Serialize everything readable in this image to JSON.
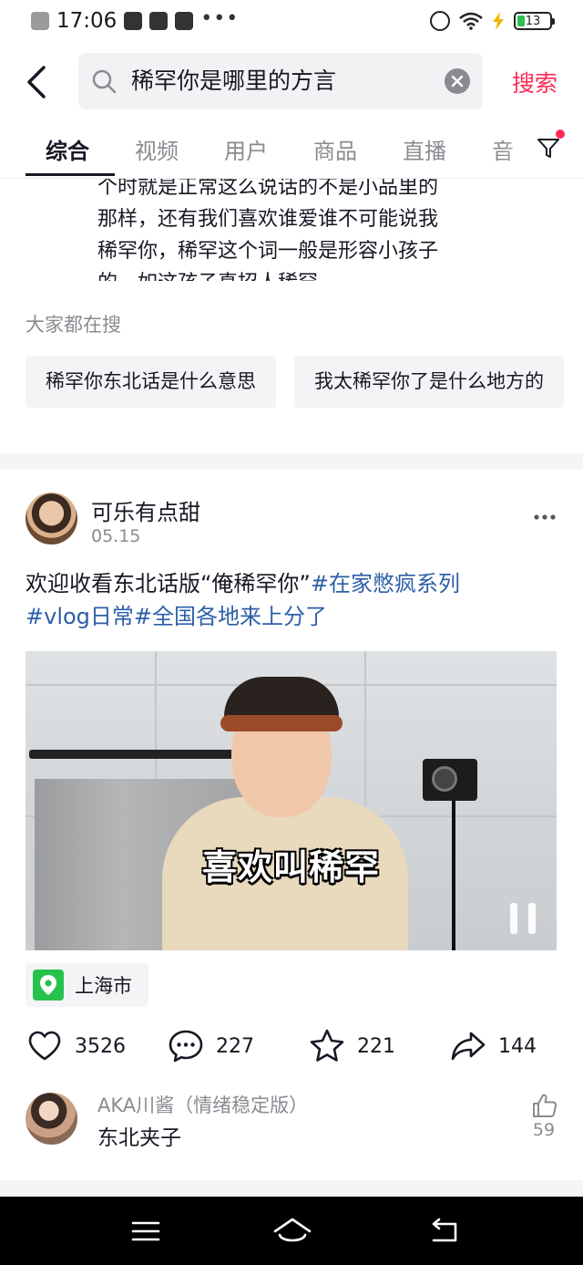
{
  "status_bar": {
    "time": "17:06",
    "battery": "13",
    "icons": [
      "close-notification-icon",
      "wechat-icon",
      "app-icon",
      "message-icon",
      "more-dots-icon",
      "alarm-icon",
      "wifi-icon",
      "charging-icon",
      "battery-icon"
    ],
    "dots": "•••"
  },
  "search": {
    "query": "稀罕你是哪里的方言",
    "submit_label": "搜索",
    "accent": "#fe2c55"
  },
  "tabs": [
    {
      "label": "综合",
      "active": true
    },
    {
      "label": "视频"
    },
    {
      "label": "用户"
    },
    {
      "label": "商品"
    },
    {
      "label": "直播"
    },
    {
      "label": "音"
    }
  ],
  "answer": {
    "lines": [
      "个时就是正常这么说话的不是小品里的",
      "那样，还有我们喜欢谁爱谁不可能说我",
      "稀罕你，稀罕这个词一般是形容小孩子",
      "的，如这孩子真招人稀罕。"
    ]
  },
  "everyone_searching": {
    "title": "大家都在搜",
    "chips": [
      "稀罕你东北话是什么意思",
      "我太稀罕你了是什么地方的"
    ]
  },
  "post": {
    "author": "可乐有点甜",
    "date": "05.15",
    "caption_text": "欢迎收看东北话版“俺稀罕你”",
    "hashtags": [
      "#在家憋疯系列",
      "#vlog日常",
      "#全国各地来上分了"
    ],
    "video_subtitle": "喜欢叫稀罕",
    "location": "上海市",
    "stats": {
      "likes": "3526",
      "comments": "227",
      "favorites": "221",
      "shares": "144"
    }
  },
  "top_comment": {
    "user": "AKA川酱（情绪稳定版）",
    "text": "东北夹子",
    "likes": "59"
  },
  "hashtag_color": "#2c5fa8"
}
